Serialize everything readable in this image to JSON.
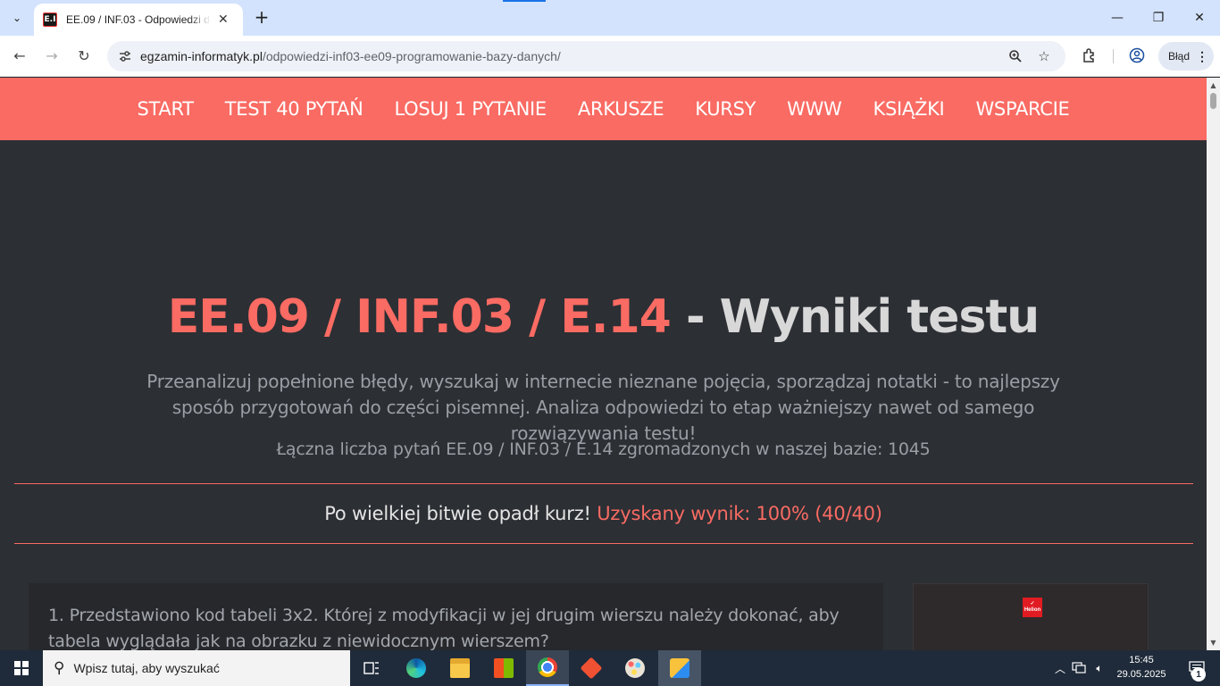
{
  "browser": {
    "tab": {
      "favicon_text": "E.I",
      "title": "EE.09 / INF.03 - Odpowiedzi do",
      "close_glyph": "✕"
    },
    "new_tab_glyph": "+",
    "window_controls": {
      "minimize": "—",
      "restore": "❐",
      "close": "✕"
    },
    "nav": {
      "back": "←",
      "forward": "→",
      "reload": "↻"
    },
    "url": {
      "host": "egzamin-informatyk.pl",
      "path": "/odpowiedzi-inf03-ee09-programowanie-bazy-danych/"
    },
    "omnibox_icons": {
      "zoom": "🔍",
      "bookmark": "☆"
    },
    "error_button_label": "Błąd",
    "accent_color": "#1a73e8"
  },
  "site": {
    "nav_items": [
      {
        "label": "START"
      },
      {
        "label": "TEST 40 PYTAŃ"
      },
      {
        "label": "LOSUJ 1 PYTANIE"
      },
      {
        "label": "ARKUSZE"
      },
      {
        "label": "KURSY"
      },
      {
        "label": "WWW"
      },
      {
        "label": "KSIĄŻKI"
      },
      {
        "label": "WSPARCIE"
      }
    ],
    "nav_color": "#f96b63",
    "background_color": "#2c2f34",
    "hero": {
      "title_accent": "EE.09 / INF.03 / E.14",
      "title_rest": " - Wyniki testu",
      "description": "Przeanalizuj popełnione błędy, wyszukaj w internecie nieznane pojęcia, sporządzaj notatki - to najlepszy sposób przygotowań do części pisemnej. Analiza odpowiedzi to etap ważniejszy nawet od samego rozwiązywania testu!",
      "count_text": "Łączna liczba pytań EE.09 / INF.03 / E.14 zgromadzonych w naszej bazie: 1045"
    },
    "result": {
      "prefix": "Po wielkiej bitwie opadł kurz! ",
      "score": "Uzyskany wynik: 100% (40/40)"
    },
    "question": {
      "text": "1. Przedstawiono kod tabeli 3x2. Której z modyfikacji w jej drugim wierszu należy dokonać, aby tabela wyglądała jak na obrazku z niewidocznym wierszem?"
    },
    "ad": {
      "logo_text": "Helion"
    }
  },
  "taskbar": {
    "search_placeholder": "Wpisz tutaj, aby wyszukać",
    "apps": [
      "task-view",
      "edge",
      "file-explorer",
      "store",
      "chrome",
      "git",
      "paint",
      "app"
    ],
    "clock_time": "15:45",
    "clock_date": "29.05.2025",
    "notification_count": "1"
  }
}
